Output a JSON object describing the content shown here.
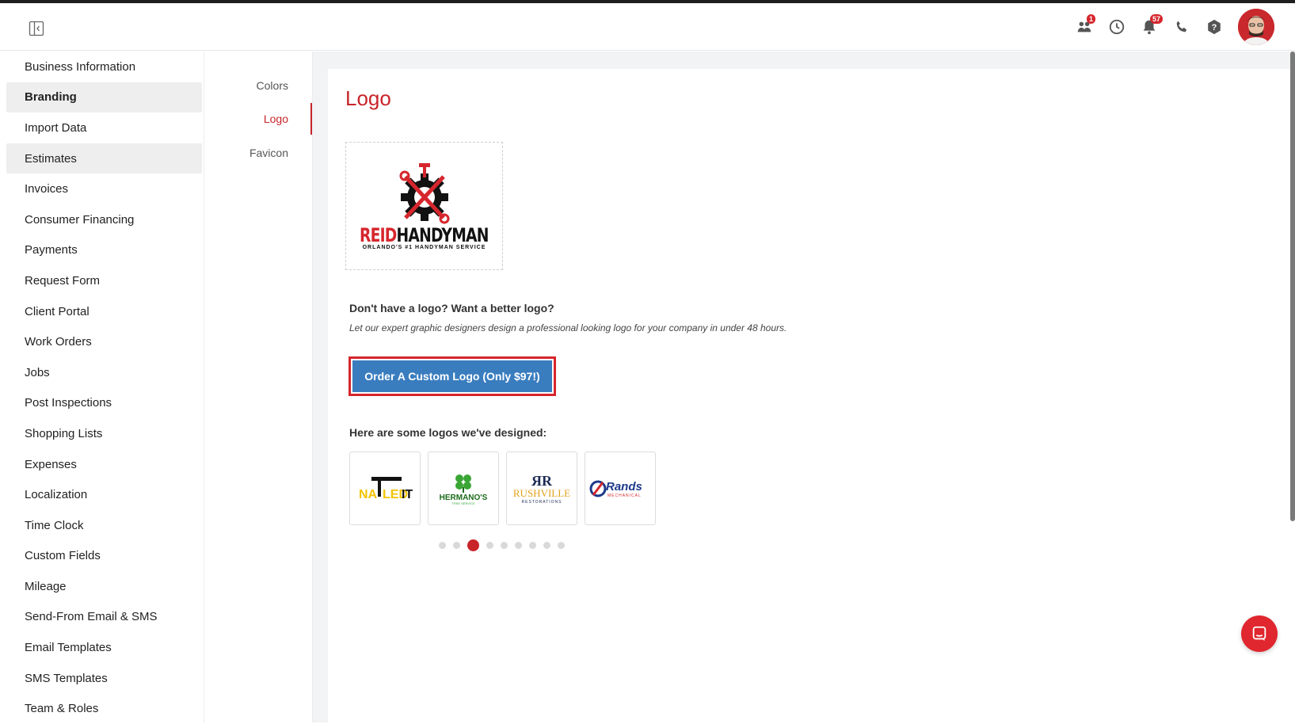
{
  "header": {
    "collapse_icon": "sidebar-collapse-icon",
    "team_badge": "1",
    "notifications_badge": "57",
    "icons": [
      "team-icon",
      "clock-icon",
      "bell-icon",
      "phone-icon",
      "help-icon"
    ],
    "accent_color": "#c8242a"
  },
  "sidebar": {
    "items": [
      {
        "label": "Business Information"
      },
      {
        "label": "Branding"
      },
      {
        "label": "Import Data"
      },
      {
        "label": "Estimates"
      },
      {
        "label": "Invoices"
      },
      {
        "label": "Consumer Financing"
      },
      {
        "label": "Payments"
      },
      {
        "label": "Request Form"
      },
      {
        "label": "Client Portal"
      },
      {
        "label": "Work Orders"
      },
      {
        "label": "Jobs"
      },
      {
        "label": "Post Inspections"
      },
      {
        "label": "Shopping Lists"
      },
      {
        "label": "Expenses"
      },
      {
        "label": "Localization"
      },
      {
        "label": "Time Clock"
      },
      {
        "label": "Custom Fields"
      },
      {
        "label": "Mileage"
      },
      {
        "label": "Send-From Email & SMS"
      },
      {
        "label": "Email Templates"
      },
      {
        "label": "SMS Templates"
      },
      {
        "label": "Team & Roles"
      }
    ],
    "active": "Branding"
  },
  "subnav": {
    "items": [
      {
        "label": "Colors"
      },
      {
        "label": "Logo"
      },
      {
        "label": "Favicon"
      }
    ],
    "active": "Logo"
  },
  "main": {
    "title": "Logo",
    "company_logo": {
      "name_red": "REID",
      "name_black": "HANDYMAN",
      "tagline": "ORLANDO'S #1 HANDYMAN SERVICE"
    },
    "promo_title": "Don't have a logo? Want a better logo?",
    "promo_subtitle": "Let our expert graphic designers design a professional looking logo for your company in under 48 hours.",
    "order_button": "Order A Custom Logo (Only $97!)",
    "samples_title": "Here are some logos we've designed:",
    "samples": [
      {
        "text_a": "NA",
        "text_b": "LED",
        "text_c": "IT"
      },
      {
        "text_a": "HERMANO'S",
        "text_b": "TREE SERVICE"
      },
      {
        "text_a": "RUSHVILLE",
        "text_b": "RESTORATIONS"
      },
      {
        "text_a": "Rands",
        "text_b": "MECHANICAL"
      }
    ],
    "carousel_dots": 9,
    "carousel_active": 3
  }
}
